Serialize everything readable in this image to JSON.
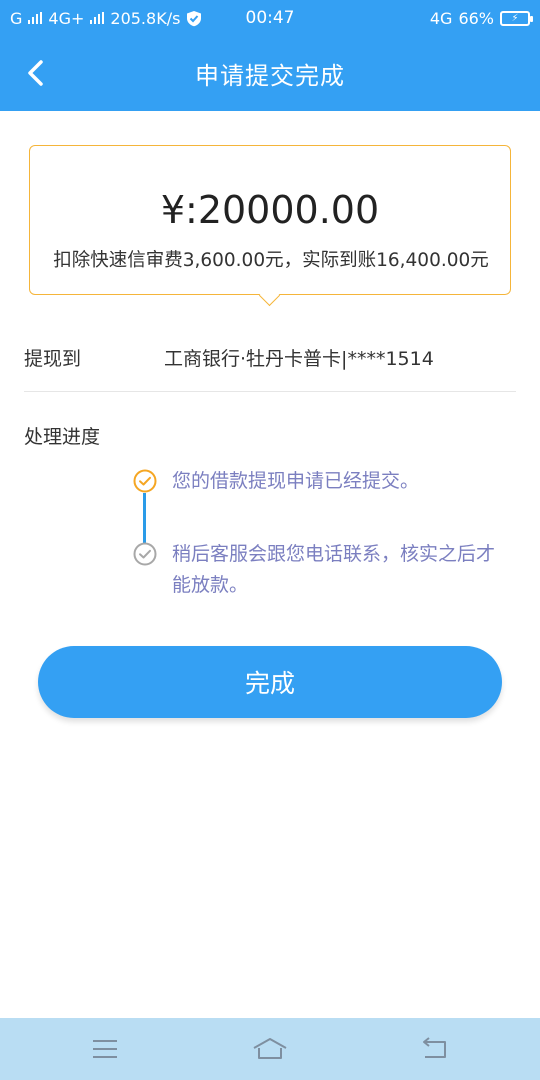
{
  "status_bar": {
    "carrier1": "G",
    "carrier2": "4G+",
    "speed": "205.8K/s",
    "time": "00:47",
    "network": "4G",
    "battery_pct": "66%"
  },
  "header": {
    "title": "申请提交完成",
    "accent_color": "#34a0f3"
  },
  "amount_card": {
    "amount": "¥:20000.00",
    "fee_note": "扣除快速信审费3,600.00元，实际到账16,400.00元",
    "border_color": "#f5b53a"
  },
  "withdraw": {
    "label": "提现到",
    "value": "工商银行·牡丹卡普卡|****1514"
  },
  "progress": {
    "title": "处理进度",
    "steps": [
      {
        "text": "您的借款提现申请已经提交。",
        "status": "done",
        "icon": "check-circle-icon"
      },
      {
        "text": "稍后客服会跟您电话联系，核实之后才能放款。",
        "status": "pending",
        "icon": "check-circle-icon"
      }
    ]
  },
  "actions": {
    "done_label": "完成"
  },
  "nav_bar": {
    "icons": [
      "menu-icon",
      "home-icon",
      "back-icon"
    ]
  }
}
